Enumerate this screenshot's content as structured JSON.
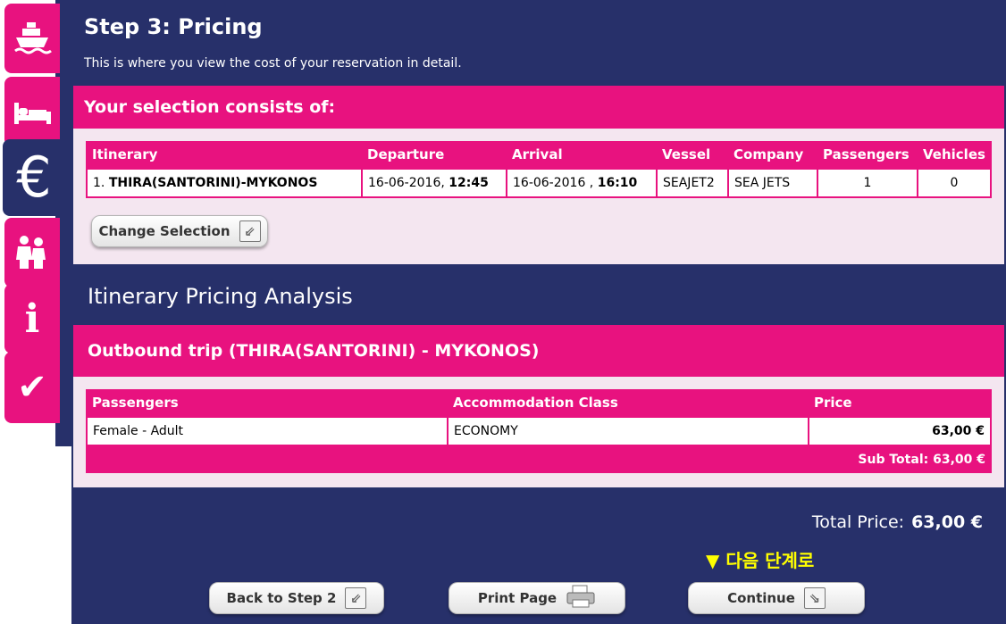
{
  "colors": {
    "navy": "#27306a",
    "magenta": "#e8127f",
    "panel": "#f4e6f0",
    "hint": "#ffff00"
  },
  "tabs": [
    {
      "icon": "ship-icon"
    },
    {
      "icon": "bed-icon"
    },
    {
      "icon": "euro-icon",
      "label": "€"
    },
    {
      "icon": "passengers-icon"
    },
    {
      "icon": "info-icon",
      "label": "i"
    },
    {
      "icon": "checkmark-icon",
      "label": "✔"
    }
  ],
  "header": {
    "title": "Step 3: Pricing",
    "subtitle": "This is where you view the cost of your reservation in detail."
  },
  "selection": {
    "heading": "Your selection consists of:",
    "columns": [
      "Itinerary",
      "Departure",
      "Arrival",
      "Vessel",
      "Company",
      "Passengers",
      "Vehicles"
    ],
    "row": {
      "itinerary_num": "1.",
      "itinerary": "THIRA(SANTORINI)-MYKONOS",
      "departure_date": "16-06-2016,",
      "departure_time": "12:45",
      "arrival_date": "16-06-2016 ,",
      "arrival_time": "16:10",
      "vessel": "SEAJET2",
      "company": "SEA JETS",
      "passengers": "1",
      "vehicles": "0"
    },
    "change_button": "Change Selection"
  },
  "analysis": {
    "title": "Itinerary Pricing Analysis",
    "trip_heading": "Outbound trip (THIRA(SANTORINI) - MYKONOS)",
    "columns": [
      "Passengers",
      "Accommodation Class",
      "Price"
    ],
    "row": {
      "passenger": "Female - Adult",
      "class": "ECONOMY",
      "price": "63,00 €"
    },
    "subtotal": "Sub Total: 63,00 €"
  },
  "total": {
    "label": "Total Price:",
    "value": "63,00 €"
  },
  "next_hint": "▼ 다음 단계로",
  "buttons": {
    "back": "Back to Step 2",
    "print": "Print Page",
    "continue": "Continue"
  }
}
